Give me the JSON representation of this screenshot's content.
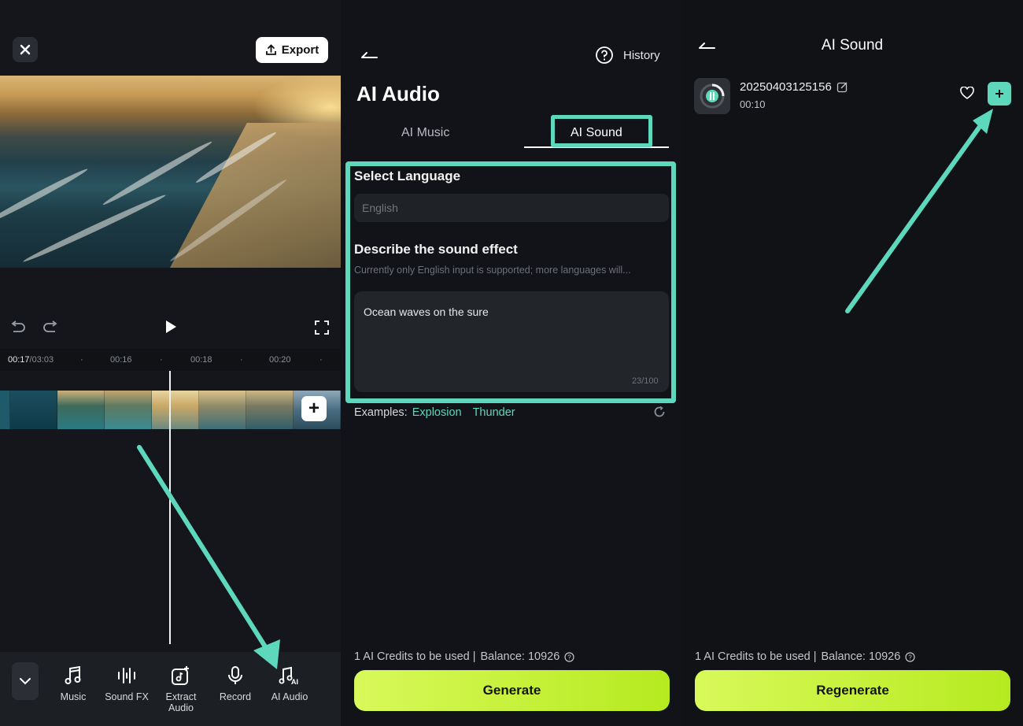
{
  "editor": {
    "export_label": "Export",
    "timecode_current": "00:17",
    "timecode_total": "/03:03",
    "ruler_ticks": [
      "00:16",
      "00:18",
      "00:20"
    ],
    "tools": [
      {
        "label": "Music",
        "icon": "music-note-icon"
      },
      {
        "label": "Sound FX",
        "icon": "sound-fx-icon"
      },
      {
        "label": "Extract Audio",
        "icon": "extract-audio-icon"
      },
      {
        "label": "Record",
        "icon": "microphone-icon"
      },
      {
        "label": "AI Audio",
        "icon": "ai-audio-icon"
      }
    ]
  },
  "ai_audio": {
    "history_label": "History",
    "title": "AI Audio",
    "tabs": [
      {
        "label": "AI Music",
        "active": false
      },
      {
        "label": "AI Sound",
        "active": true
      }
    ],
    "select_language_label": "Select Language",
    "language_placeholder": "English",
    "describe_label": "Describe the sound effect",
    "describe_hint": "Currently only English input is supported; more languages will...",
    "description_value": "Ocean waves on the sure",
    "char_counter": "23/100",
    "examples_label": "Examples:",
    "examples": [
      "Explosion",
      "Thunder"
    ],
    "credits_text": "1 AI Credits to be used |",
    "balance_text": "Balance: 10926",
    "generate_label": "Generate"
  },
  "ai_sound": {
    "title": "AI Sound",
    "item": {
      "name": "20250403125156",
      "duration": "00:10"
    },
    "credits_text": "1 AI Credits to be used |",
    "balance_text": "Balance: 10926",
    "regenerate_label": "Regenerate"
  },
  "colors": {
    "accent": "#5ed8bd",
    "cta": "#c6f23a",
    "background": "#111318"
  }
}
